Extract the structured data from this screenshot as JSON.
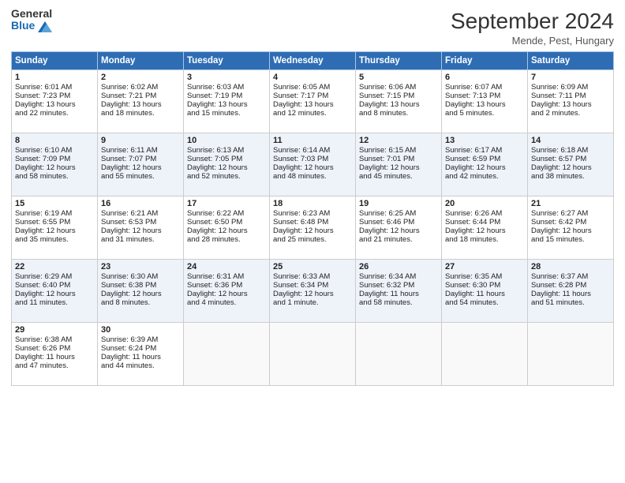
{
  "header": {
    "logo_line1": "General",
    "logo_line2": "Blue",
    "month": "September 2024",
    "location": "Mende, Pest, Hungary"
  },
  "days_of_week": [
    "Sunday",
    "Monday",
    "Tuesday",
    "Wednesday",
    "Thursday",
    "Friday",
    "Saturday"
  ],
  "weeks": [
    [
      {
        "day": "1",
        "lines": [
          "Sunrise: 6:01 AM",
          "Sunset: 7:23 PM",
          "Daylight: 13 hours",
          "and 22 minutes."
        ]
      },
      {
        "day": "2",
        "lines": [
          "Sunrise: 6:02 AM",
          "Sunset: 7:21 PM",
          "Daylight: 13 hours",
          "and 18 minutes."
        ]
      },
      {
        "day": "3",
        "lines": [
          "Sunrise: 6:03 AM",
          "Sunset: 7:19 PM",
          "Daylight: 13 hours",
          "and 15 minutes."
        ]
      },
      {
        "day": "4",
        "lines": [
          "Sunrise: 6:05 AM",
          "Sunset: 7:17 PM",
          "Daylight: 13 hours",
          "and 12 minutes."
        ]
      },
      {
        "day": "5",
        "lines": [
          "Sunrise: 6:06 AM",
          "Sunset: 7:15 PM",
          "Daylight: 13 hours",
          "and 8 minutes."
        ]
      },
      {
        "day": "6",
        "lines": [
          "Sunrise: 6:07 AM",
          "Sunset: 7:13 PM",
          "Daylight: 13 hours",
          "and 5 minutes."
        ]
      },
      {
        "day": "7",
        "lines": [
          "Sunrise: 6:09 AM",
          "Sunset: 7:11 PM",
          "Daylight: 13 hours",
          "and 2 minutes."
        ]
      }
    ],
    [
      {
        "day": "8",
        "lines": [
          "Sunrise: 6:10 AM",
          "Sunset: 7:09 PM",
          "Daylight: 12 hours",
          "and 58 minutes."
        ]
      },
      {
        "day": "9",
        "lines": [
          "Sunrise: 6:11 AM",
          "Sunset: 7:07 PM",
          "Daylight: 12 hours",
          "and 55 minutes."
        ]
      },
      {
        "day": "10",
        "lines": [
          "Sunrise: 6:13 AM",
          "Sunset: 7:05 PM",
          "Daylight: 12 hours",
          "and 52 minutes."
        ]
      },
      {
        "day": "11",
        "lines": [
          "Sunrise: 6:14 AM",
          "Sunset: 7:03 PM",
          "Daylight: 12 hours",
          "and 48 minutes."
        ]
      },
      {
        "day": "12",
        "lines": [
          "Sunrise: 6:15 AM",
          "Sunset: 7:01 PM",
          "Daylight: 12 hours",
          "and 45 minutes."
        ]
      },
      {
        "day": "13",
        "lines": [
          "Sunrise: 6:17 AM",
          "Sunset: 6:59 PM",
          "Daylight: 12 hours",
          "and 42 minutes."
        ]
      },
      {
        "day": "14",
        "lines": [
          "Sunrise: 6:18 AM",
          "Sunset: 6:57 PM",
          "Daylight: 12 hours",
          "and 38 minutes."
        ]
      }
    ],
    [
      {
        "day": "15",
        "lines": [
          "Sunrise: 6:19 AM",
          "Sunset: 6:55 PM",
          "Daylight: 12 hours",
          "and 35 minutes."
        ]
      },
      {
        "day": "16",
        "lines": [
          "Sunrise: 6:21 AM",
          "Sunset: 6:53 PM",
          "Daylight: 12 hours",
          "and 31 minutes."
        ]
      },
      {
        "day": "17",
        "lines": [
          "Sunrise: 6:22 AM",
          "Sunset: 6:50 PM",
          "Daylight: 12 hours",
          "and 28 minutes."
        ]
      },
      {
        "day": "18",
        "lines": [
          "Sunrise: 6:23 AM",
          "Sunset: 6:48 PM",
          "Daylight: 12 hours",
          "and 25 minutes."
        ]
      },
      {
        "day": "19",
        "lines": [
          "Sunrise: 6:25 AM",
          "Sunset: 6:46 PM",
          "Daylight: 12 hours",
          "and 21 minutes."
        ]
      },
      {
        "day": "20",
        "lines": [
          "Sunrise: 6:26 AM",
          "Sunset: 6:44 PM",
          "Daylight: 12 hours",
          "and 18 minutes."
        ]
      },
      {
        "day": "21",
        "lines": [
          "Sunrise: 6:27 AM",
          "Sunset: 6:42 PM",
          "Daylight: 12 hours",
          "and 15 minutes."
        ]
      }
    ],
    [
      {
        "day": "22",
        "lines": [
          "Sunrise: 6:29 AM",
          "Sunset: 6:40 PM",
          "Daylight: 12 hours",
          "and 11 minutes."
        ]
      },
      {
        "day": "23",
        "lines": [
          "Sunrise: 6:30 AM",
          "Sunset: 6:38 PM",
          "Daylight: 12 hours",
          "and 8 minutes."
        ]
      },
      {
        "day": "24",
        "lines": [
          "Sunrise: 6:31 AM",
          "Sunset: 6:36 PM",
          "Daylight: 12 hours",
          "and 4 minutes."
        ]
      },
      {
        "day": "25",
        "lines": [
          "Sunrise: 6:33 AM",
          "Sunset: 6:34 PM",
          "Daylight: 12 hours",
          "and 1 minute."
        ]
      },
      {
        "day": "26",
        "lines": [
          "Sunrise: 6:34 AM",
          "Sunset: 6:32 PM",
          "Daylight: 11 hours",
          "and 58 minutes."
        ]
      },
      {
        "day": "27",
        "lines": [
          "Sunrise: 6:35 AM",
          "Sunset: 6:30 PM",
          "Daylight: 11 hours",
          "and 54 minutes."
        ]
      },
      {
        "day": "28",
        "lines": [
          "Sunrise: 6:37 AM",
          "Sunset: 6:28 PM",
          "Daylight: 11 hours",
          "and 51 minutes."
        ]
      }
    ],
    [
      {
        "day": "29",
        "lines": [
          "Sunrise: 6:38 AM",
          "Sunset: 6:26 PM",
          "Daylight: 11 hours",
          "and 47 minutes."
        ]
      },
      {
        "day": "30",
        "lines": [
          "Sunrise: 6:39 AM",
          "Sunset: 6:24 PM",
          "Daylight: 11 hours",
          "and 44 minutes."
        ]
      },
      {
        "day": "",
        "lines": []
      },
      {
        "day": "",
        "lines": []
      },
      {
        "day": "",
        "lines": []
      },
      {
        "day": "",
        "lines": []
      },
      {
        "day": "",
        "lines": []
      }
    ]
  ]
}
